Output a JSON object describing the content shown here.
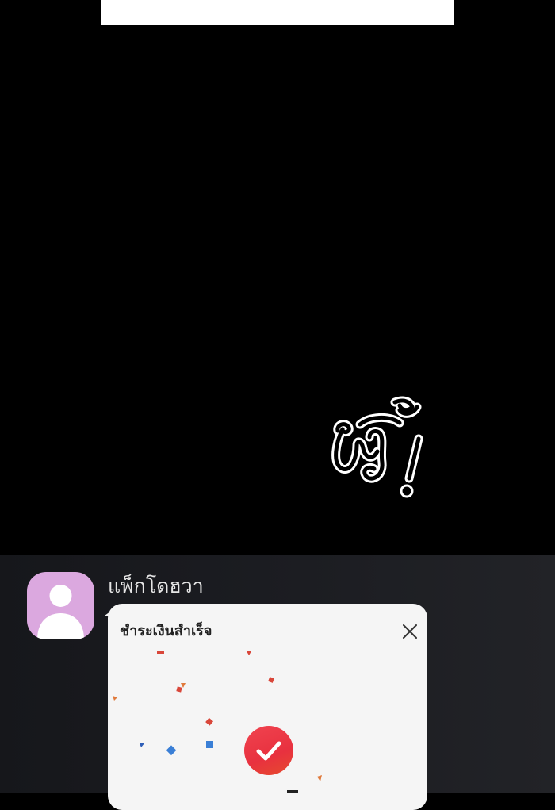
{
  "comic": {
    "sound_effect": "ติ๊ง!"
  },
  "chat": {
    "sender_name": "แพ็กโดฮวา",
    "message": {
      "title": "ชำระเงินสำเร็จ",
      "close_icon": "close-icon",
      "status_icon": "check-circle-icon"
    }
  },
  "colors": {
    "background": "#000000",
    "chat_background": "#1c1d22",
    "avatar_bg": "#dba8df",
    "bubble_bg": "#f5f5f5",
    "check_red": "#e8313f"
  }
}
